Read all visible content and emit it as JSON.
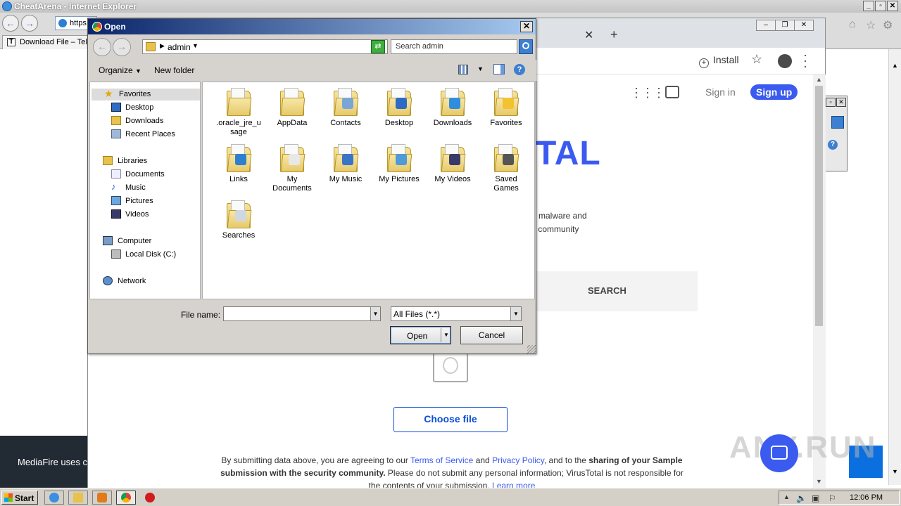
{
  "ie": {
    "title": "CheatArena - Internet Explorer",
    "url_fragment": "https",
    "tab_label": "Download File – Tele",
    "tab_icon_letter": "T"
  },
  "chrome": {
    "install_label": "Install"
  },
  "virustotal": {
    "signin": "Sign in",
    "signup": "Sign up",
    "logo_fragment": "TAL",
    "desc_line1": "malware and",
    "desc_line2": "y community",
    "search_tab": "SEARCH",
    "choose_file": "Choose file",
    "legal": {
      "p1": "By submitting data above, you are agreeing to our ",
      "terms": "Terms of Service",
      "and": " and ",
      "privacy": "Privacy Policy",
      "p2": ", and to the ",
      "bold": "sharing of your Sample submission with the security community.",
      "p3": " Please do not submit any personal information; VirusTotal is not responsible for the contents of your submission. ",
      "learn": "Learn more"
    }
  },
  "mediafire_banner": "MediaFire uses c",
  "watermark": "ANY.RUN",
  "dialog": {
    "title": "Open",
    "close": "✕",
    "path_folder": "admin",
    "search_placeholder": "Search admin",
    "organize": "Organize",
    "new_folder": "New folder",
    "nav": {
      "favorites": "Favorites",
      "desktop": "Desktop",
      "downloads": "Downloads",
      "recent": "Recent Places",
      "libraries": "Libraries",
      "documents": "Documents",
      "music": "Music",
      "pictures": "Pictures",
      "videos": "Videos",
      "computer": "Computer",
      "local_disk": "Local Disk (C:)",
      "network": "Network"
    },
    "files": [
      {
        "l1": ".oracle_jre_u",
        "l2": "sage",
        "badge": ""
      },
      {
        "l1": "AppData",
        "l2": "",
        "badge": ""
      },
      {
        "l1": "Contacts",
        "l2": "",
        "badge": "#7aa6d6"
      },
      {
        "l1": "Desktop",
        "l2": "",
        "badge": "#2d6bc4"
      },
      {
        "l1": "Downloads",
        "l2": "",
        "badge": "#2f8de0"
      },
      {
        "l1": "Favorites",
        "l2": "",
        "badge": "#f2c230"
      },
      {
        "l1": "Links",
        "l2": "",
        "badge": "#2f7fd1"
      },
      {
        "l1": "My",
        "l2": "Documents",
        "badge": "#e8e8e8"
      },
      {
        "l1": "My Music",
        "l2": "",
        "badge": "#3a74c9"
      },
      {
        "l1": "My Pictures",
        "l2": "",
        "badge": "#4f9ad8"
      },
      {
        "l1": "My Videos",
        "l2": "",
        "badge": "#3a3a6a"
      },
      {
        "l1": "Saved",
        "l2": "Games",
        "badge": "#555555"
      },
      {
        "l1": "Searches",
        "l2": "",
        "badge": "#cfd8e0"
      }
    ],
    "file_name_label": "File name:",
    "file_name_value": "",
    "file_type": "All Files (*.*)",
    "open_label": "Open",
    "cancel_label": "Cancel"
  },
  "taskbar": {
    "start": "Start",
    "clock": "12:06 PM"
  }
}
